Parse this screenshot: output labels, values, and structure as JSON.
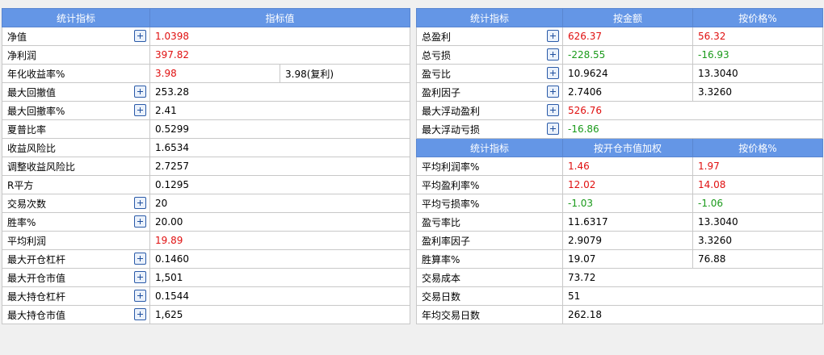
{
  "left": {
    "headers": [
      "统计指标",
      "指标值"
    ],
    "rows": [
      {
        "label": "净值",
        "plus": true,
        "v1": "1.0398",
        "v1c": "red"
      },
      {
        "label": "净利润",
        "plus": false,
        "v1": "397.82",
        "v1c": "red"
      },
      {
        "label": "年化收益率%",
        "plus": false,
        "v1": "3.98",
        "v1c": "red",
        "v2": "3.98(复利)"
      },
      {
        "label": "最大回撤值",
        "plus": true,
        "v1": "253.28"
      },
      {
        "label": "最大回撤率%",
        "plus": true,
        "v1": "2.41"
      },
      {
        "label": "夏普比率",
        "plus": false,
        "v1": "0.5299"
      },
      {
        "label": "收益风险比",
        "plus": false,
        "v1": "1.6534"
      },
      {
        "label": "调整收益风险比",
        "plus": false,
        "v1": "2.7257"
      },
      {
        "label": "R平方",
        "plus": false,
        "v1": "0.1295"
      },
      {
        "label": "交易次数",
        "plus": true,
        "v1": "20"
      },
      {
        "label": "胜率%",
        "plus": true,
        "v1": "20.00"
      },
      {
        "label": "平均利润",
        "plus": false,
        "v1": "19.89",
        "v1c": "red"
      },
      {
        "label": "最大开仓杠杆",
        "plus": true,
        "v1": "0.1460"
      },
      {
        "label": "最大开仓市值",
        "plus": true,
        "v1": "1,501"
      },
      {
        "label": "最大持仓杠杆",
        "plus": true,
        "v1": "0.1544"
      },
      {
        "label": "最大持仓市值",
        "plus": true,
        "v1": "1,625"
      }
    ]
  },
  "right": {
    "headers": [
      "统计指标",
      "按金额",
      "按价格%"
    ],
    "rows": [
      {
        "label": "总盈利",
        "plus": true,
        "v1": "626.37",
        "v1c": "red",
        "v2": "56.32",
        "v2c": "red"
      },
      {
        "label": "总亏损",
        "plus": true,
        "v1": "-228.55",
        "v1c": "green",
        "v2": "-16.93",
        "v2c": "green"
      },
      {
        "label": "盈亏比",
        "plus": true,
        "v1": "10.9624",
        "v2": "13.3040"
      },
      {
        "label": "盈利因子",
        "plus": true,
        "v1": "2.7406",
        "v2": "3.3260"
      },
      {
        "label": "最大浮动盈利",
        "plus": true,
        "v1": "526.76",
        "v1c": "red"
      },
      {
        "label": "最大浮动亏损",
        "plus": true,
        "v1": "-16.86",
        "v1c": "green"
      }
    ],
    "headers2": [
      "统计指标",
      "按开仓市值加权",
      "按价格%"
    ],
    "rows2": [
      {
        "label": "平均利润率%",
        "v1": "1.46",
        "v1c": "red",
        "v2": "1.97",
        "v2c": "red"
      },
      {
        "label": "平均盈利率%",
        "v1": "12.02",
        "v1c": "red",
        "v2": "14.08",
        "v2c": "red"
      },
      {
        "label": "平均亏损率%",
        "v1": "-1.03",
        "v1c": "green",
        "v2": "-1.06",
        "v2c": "green"
      },
      {
        "label": "盈亏率比",
        "v1": "11.6317",
        "v2": "13.3040"
      },
      {
        "label": "盈利率因子",
        "v1": "2.9079",
        "v2": "3.3260"
      },
      {
        "label": "胜算率%",
        "v1": "19.07",
        "v2": "76.88"
      },
      {
        "label": "交易成本",
        "v1": "73.72"
      },
      {
        "label": "交易日数",
        "v1": "51"
      },
      {
        "label": "年均交易日数",
        "v1": "262.18"
      }
    ]
  },
  "colors": {
    "header": "#6496e6",
    "positive": "#e01010",
    "negative": "#1a9a1a",
    "border": "#c8c8c8"
  }
}
